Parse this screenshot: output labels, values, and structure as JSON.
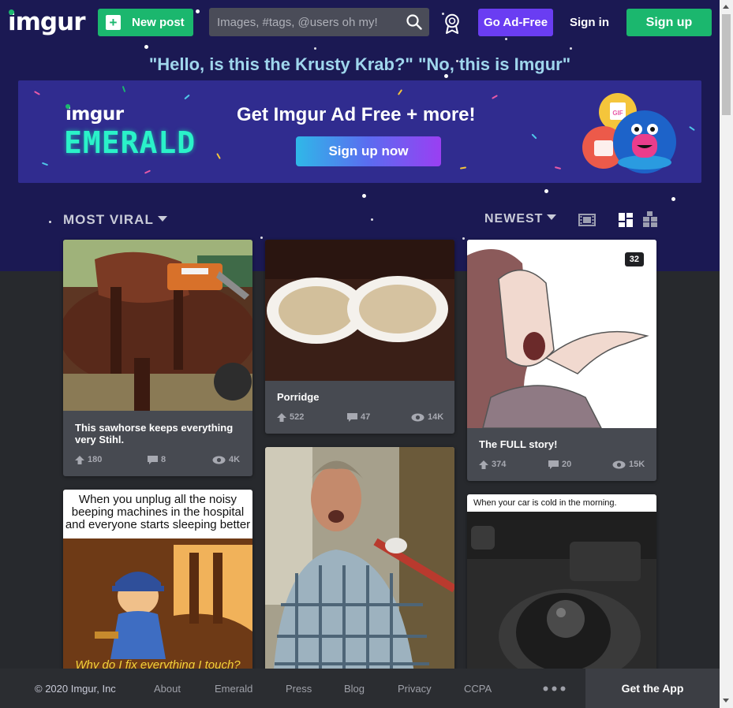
{
  "header": {
    "logo": "imgur",
    "new_post_label": "New post",
    "search_placeholder": "Images, #tags, @users oh my!",
    "go_ad_free_label": "Go Ad-Free",
    "sign_in_label": "Sign in",
    "sign_up_label": "Sign up"
  },
  "tagline": "\"Hello, is this the Krusty Krab?\" \"No, this is Imgur\"",
  "banner": {
    "brand_small": "imgur",
    "brand_big": "EMERALD",
    "title": "Get Imgur Ad Free + more!",
    "cta_label": "Sign up now",
    "gif_label": "GIF"
  },
  "filters": {
    "section_label": "MOST VIRAL",
    "sort_label": "NEWEST"
  },
  "posts": [
    {
      "title": "This sawhorse keeps everything very Stihl.",
      "upvotes": "180",
      "comments": "8",
      "views": "4K"
    },
    {
      "title": "Porridge",
      "upvotes": "522",
      "comments": "47",
      "views": "14K"
    },
    {
      "title": "The FULL story!",
      "upvotes": "374",
      "comments": "20",
      "views": "15K",
      "badge": "32"
    },
    {
      "caption_top": "When you unplug all the noisy beeping machines in the hospital and everyone starts sleeping better",
      "caption_bottom": "Why do I fix everything I touch?"
    },
    {},
    {
      "caption_top": "When your car is cold in the morning."
    }
  ],
  "footer": {
    "copyright": "© 2020 Imgur, Inc",
    "links": [
      "About",
      "Emerald",
      "Press",
      "Blog",
      "Privacy",
      "CCPA"
    ],
    "get_app_label": "Get the App"
  },
  "colors": {
    "hero_bg": "#1b1953",
    "page_bg": "#27292d",
    "green": "#1bb76e",
    "purple": "#6a3df2",
    "tagline": "#9fd6ec",
    "card_bg": "#474a51"
  }
}
